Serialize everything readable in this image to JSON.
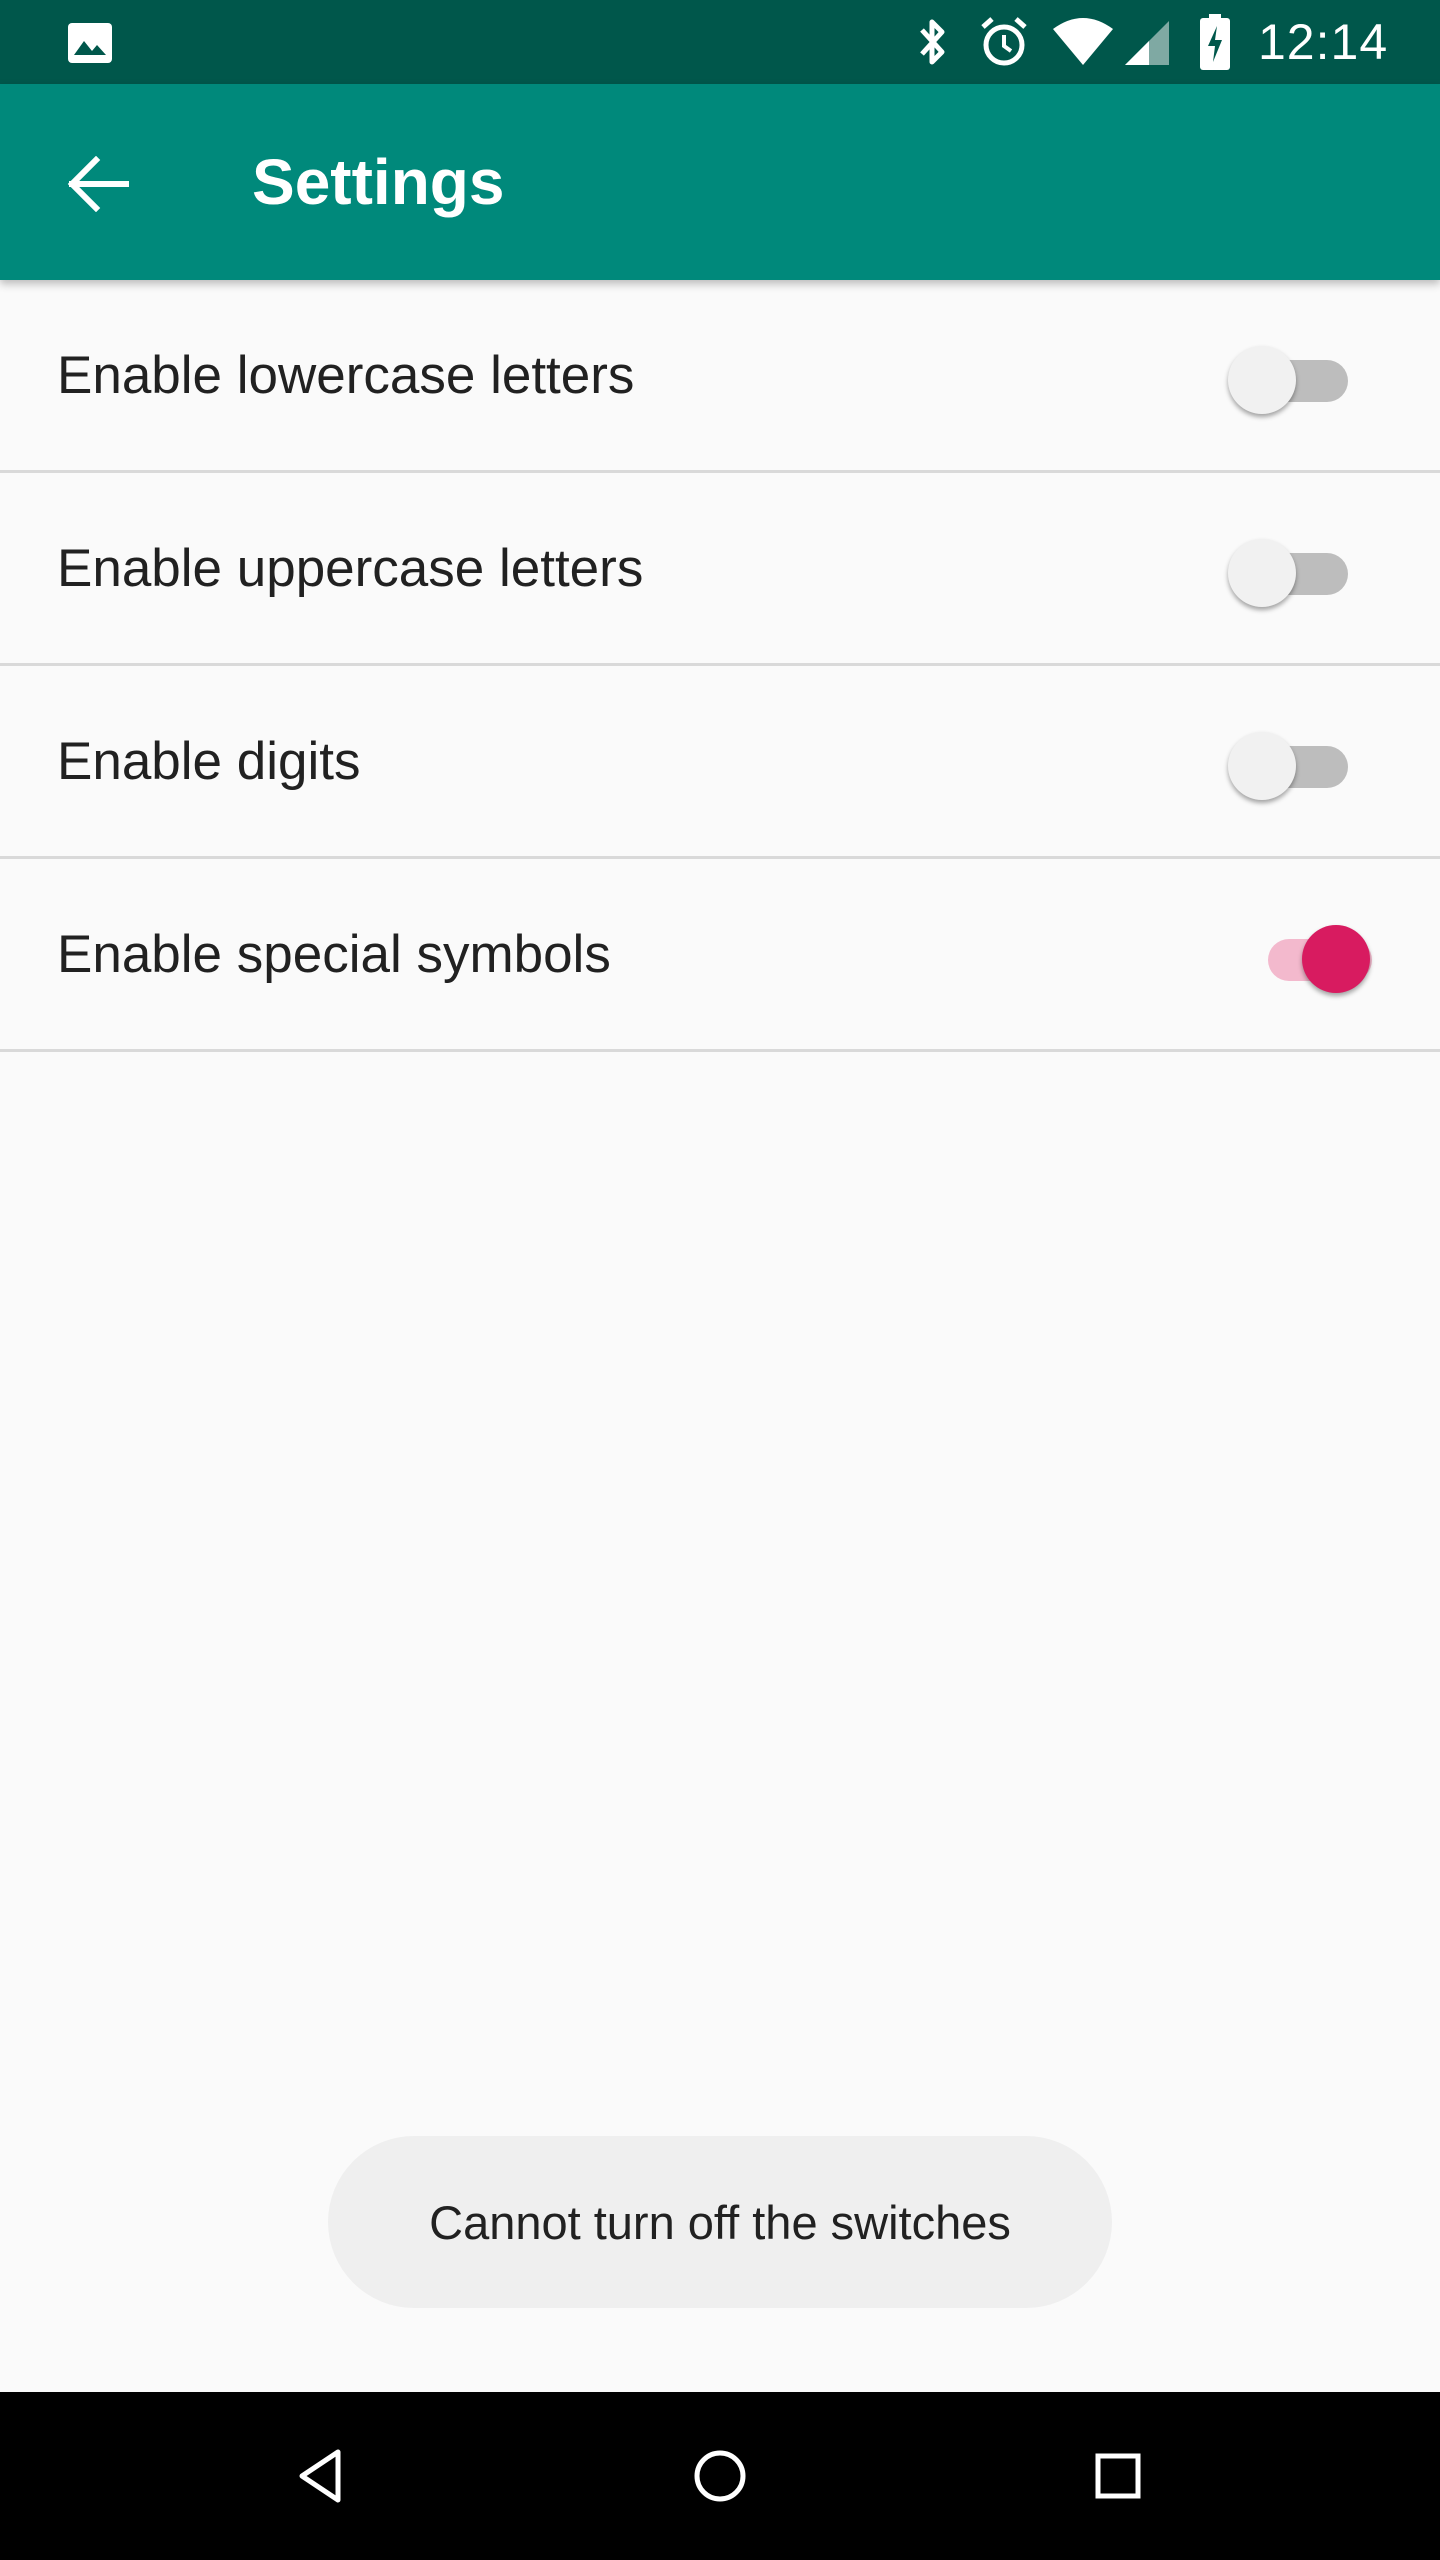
{
  "status_bar": {
    "time": "12:14",
    "icons": [
      "gallery-icon",
      "bluetooth-icon",
      "alarm-icon",
      "wifi-icon",
      "signal-icon",
      "battery-charging-icon"
    ]
  },
  "app_bar": {
    "title": "Settings",
    "back_icon": "arrow-back-icon"
  },
  "settings": [
    {
      "label": "Enable lowercase letters",
      "enabled": false
    },
    {
      "label": "Enable uppercase letters",
      "enabled": false
    },
    {
      "label": "Enable digits",
      "enabled": false
    },
    {
      "label": "Enable special symbols",
      "enabled": true
    }
  ],
  "toast": {
    "message": "Cannot turn off the switches"
  },
  "nav_bar": {
    "buttons": [
      "nav-back-icon",
      "nav-home-icon",
      "nav-recents-icon"
    ]
  },
  "colors": {
    "status_bar": "#00574b",
    "app_bar": "#00897b",
    "switch_on_thumb": "#d81b60",
    "switch_on_track": "#f3b9cd",
    "background": "#fafafa"
  }
}
